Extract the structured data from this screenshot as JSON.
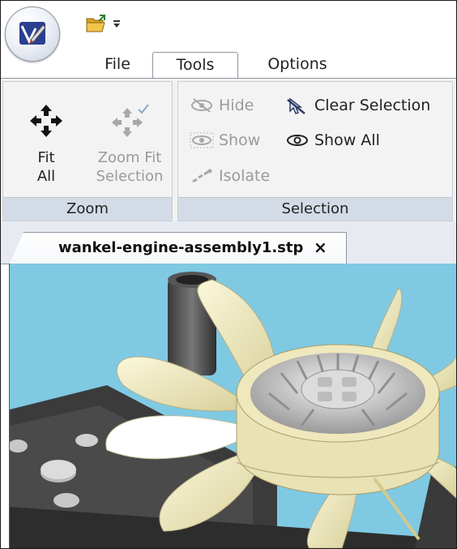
{
  "tabs": {
    "file": "File",
    "tools": "Tools",
    "options": "Options",
    "active": "Tools"
  },
  "ribbon": {
    "zoom_group": {
      "label": "Zoom",
      "fit_all": {
        "label": "Fit\nAll",
        "icon": "fit-all-arrows-icon",
        "enabled": true
      },
      "zoom_fit_selection": {
        "label": "Zoom Fit\nSelection",
        "icon": "zoom-fit-selection-icon",
        "enabled": false
      }
    },
    "selection_group": {
      "label": "Selection",
      "hide": {
        "label": "Hide",
        "icon": "eye-hidden-icon",
        "enabled": false
      },
      "show": {
        "label": "Show",
        "icon": "eye-icon",
        "enabled": false
      },
      "isolate": {
        "label": "Isolate",
        "icon": "isolate-icon",
        "enabled": false
      },
      "clear_selection": {
        "label": "Clear Selection",
        "icon": "clear-selection-icon",
        "enabled": true
      },
      "show_all": {
        "label": "Show All",
        "icon": "eye-icon",
        "enabled": true
      }
    }
  },
  "qat": {
    "items": [
      "open-folder-icon",
      "customize-dropdown-icon"
    ]
  },
  "document": {
    "tab_title": "wankel-engine-assembly1.stp",
    "close_glyph": "×"
  },
  "colors": {
    "viewport_bg": "#7fc9e3",
    "group_label_bg": "#d3dbe6",
    "fan_blade": "#f3efc4"
  }
}
